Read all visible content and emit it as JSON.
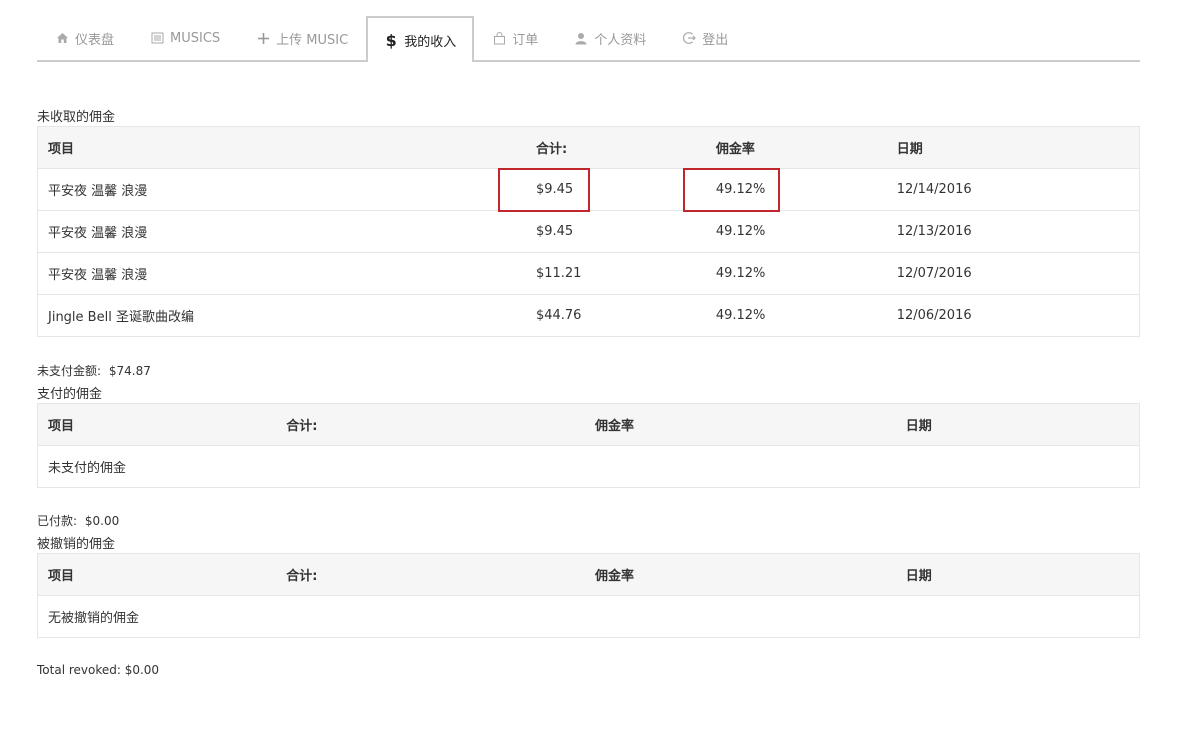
{
  "tabs": [
    {
      "label": "仪表盘",
      "icon": "home-icon",
      "active": false
    },
    {
      "label": "MUSICS",
      "icon": "list-icon",
      "active": false
    },
    {
      "label": "上传 MUSIC",
      "icon": "plus-icon",
      "active": false
    },
    {
      "label": "我的收入",
      "icon": "dollar-icon",
      "active": true
    },
    {
      "label": "订单",
      "icon": "bag-icon",
      "active": false
    },
    {
      "label": "个人资料",
      "icon": "user-icon",
      "active": false
    },
    {
      "label": "登出",
      "icon": "logout-icon",
      "active": false
    }
  ],
  "unpaid": {
    "title": "未收取的佣金",
    "headers": [
      "项目",
      "合计:",
      "佣金率",
      "日期"
    ],
    "rows": [
      {
        "item": "平安夜 温馨 浪漫",
        "total": "$9.45",
        "rate": "49.12%",
        "date": "12/14/2016"
      },
      {
        "item": "平安夜 温馨 浪漫",
        "total": "$9.45",
        "rate": "49.12%",
        "date": "12/13/2016"
      },
      {
        "item": "平安夜 温馨 浪漫",
        "total": "$11.21",
        "rate": "49.12%",
        "date": "12/07/2016"
      },
      {
        "item": "Jingle Bell 圣诞歌曲改编",
        "total": "$44.76",
        "rate": "49.12%",
        "date": "12/06/2016"
      }
    ],
    "summary_label": "未支付金额:",
    "summary_value": "$74.87"
  },
  "paid": {
    "title": "支付的佣金",
    "headers": [
      "项目",
      "合计:",
      "佣金率",
      "日期"
    ],
    "empty": "未支付的佣金",
    "summary_label": "已付款:",
    "summary_value": "$0.00"
  },
  "revoked": {
    "title": "被撤销的佣金",
    "headers": [
      "项目",
      "合计:",
      "佣金率",
      "日期"
    ],
    "empty": "无被撤销的佣金",
    "summary": "Total revoked: $0.00"
  },
  "colors": {
    "highlight": "#c0272d",
    "tab_border": "#cccccc",
    "header_bg": "#f6f6f6"
  }
}
